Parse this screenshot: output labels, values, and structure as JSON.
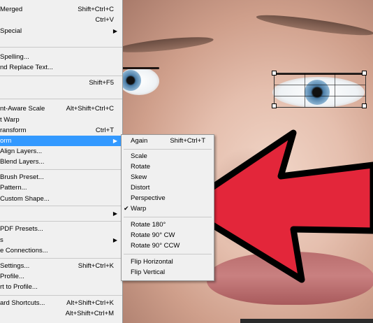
{
  "main_menu": {
    "items": [
      {
        "label": "Merged",
        "shortcut": "Shift+Ctrl+C"
      },
      {
        "label": "",
        "shortcut": "Ctrl+V"
      },
      {
        "label": "Special",
        "submenu": true
      },
      {
        "label": "Spelling..."
      },
      {
        "label": "nd Replace Text..."
      },
      {
        "label": "",
        "shortcut": "Shift+F5"
      },
      {
        "label": "nt-Aware Scale",
        "shortcut": "Alt+Shift+Ctrl+C"
      },
      {
        "label": "t Warp"
      },
      {
        "label": "ransform",
        "shortcut": "Ctrl+T"
      },
      {
        "label": "orm",
        "submenu": true,
        "highlighted": true
      },
      {
        "label": "Align Layers..."
      },
      {
        "label": "Blend Layers..."
      },
      {
        "label": "Brush Preset..."
      },
      {
        "label": "Pattern..."
      },
      {
        "label": "Custom Shape..."
      },
      {
        "label": "",
        "submenu": true
      },
      {
        "label": "PDF Presets..."
      },
      {
        "label": "s",
        "submenu": true
      },
      {
        "label": "e Connections..."
      },
      {
        "label": "Settings...",
        "shortcut": "Shift+Ctrl+K"
      },
      {
        "label": "Profile..."
      },
      {
        "label": "rt to Profile..."
      },
      {
        "label": "ard Shortcuts...",
        "shortcut": "Alt+Shift+Ctrl+K"
      },
      {
        "label": "",
        "shortcut": "Alt+Shift+Ctrl+M"
      }
    ],
    "top_partial_shortcut": "C"
  },
  "transform_submenu": {
    "items": [
      {
        "label": "Again",
        "shortcut": "Shift+Ctrl+T"
      },
      {
        "label": "Scale"
      },
      {
        "label": "Rotate"
      },
      {
        "label": "Skew"
      },
      {
        "label": "Distort"
      },
      {
        "label": "Perspective"
      },
      {
        "label": "Warp",
        "checked": true
      },
      {
        "label": "Rotate 180°"
      },
      {
        "label": "Rotate 90° CW"
      },
      {
        "label": "Rotate 90° CCW"
      },
      {
        "label": "Flip Horizontal"
      },
      {
        "label": "Flip Vertical"
      }
    ],
    "check_glyph": "✔",
    "submenu_arrow_glyph": "▶"
  },
  "colors": {
    "menu_bg": "#f0f0f0",
    "highlight": "#3399ff",
    "arrow_fill": "#e3263a",
    "arrow_stroke": "#000000"
  },
  "icons": [
    "submenu-arrow-icon",
    "checkmark-icon",
    "red-arrow-annotation"
  ]
}
